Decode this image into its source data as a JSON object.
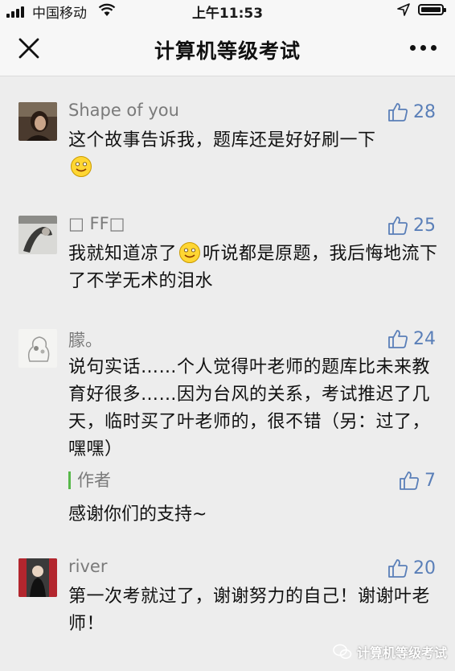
{
  "status_bar": {
    "carrier": "中国移动",
    "time": "上午11:53"
  },
  "nav": {
    "title": "计算机等级考试"
  },
  "comments": [
    {
      "nickname": "Shape of you",
      "likes": "28",
      "text_parts": [
        "这个故事告诉我，题库还是好好刷一下"
      ]
    },
    {
      "nickname": "□ FF□",
      "likes": "25",
      "text_parts": [
        "我就知道凉了",
        "听说都是原题，我后悔地流下了不学无术的泪水"
      ]
    },
    {
      "nickname": "朦。",
      "likes": "24",
      "text": "说句实话……个人觉得叶老师的题库比未来教育好很多……因为台风的关系，考试推迟了几天，临时买了叶老师的，很不错（另：过了，嘿嘿）",
      "reply": {
        "label": "作者",
        "likes": "7",
        "text": "感谢你们的支持~"
      }
    },
    {
      "nickname": "river",
      "likes": "20",
      "text": "第一次考就过了，谢谢努力的自己！谢谢叶老师！"
    }
  ],
  "watermark": "计算机等级考试",
  "colors": {
    "background": "#ededed",
    "like_blue": "#5a7fb8",
    "nickname_gray": "#7a7a7a",
    "author_bar_green": "#57b84a"
  }
}
